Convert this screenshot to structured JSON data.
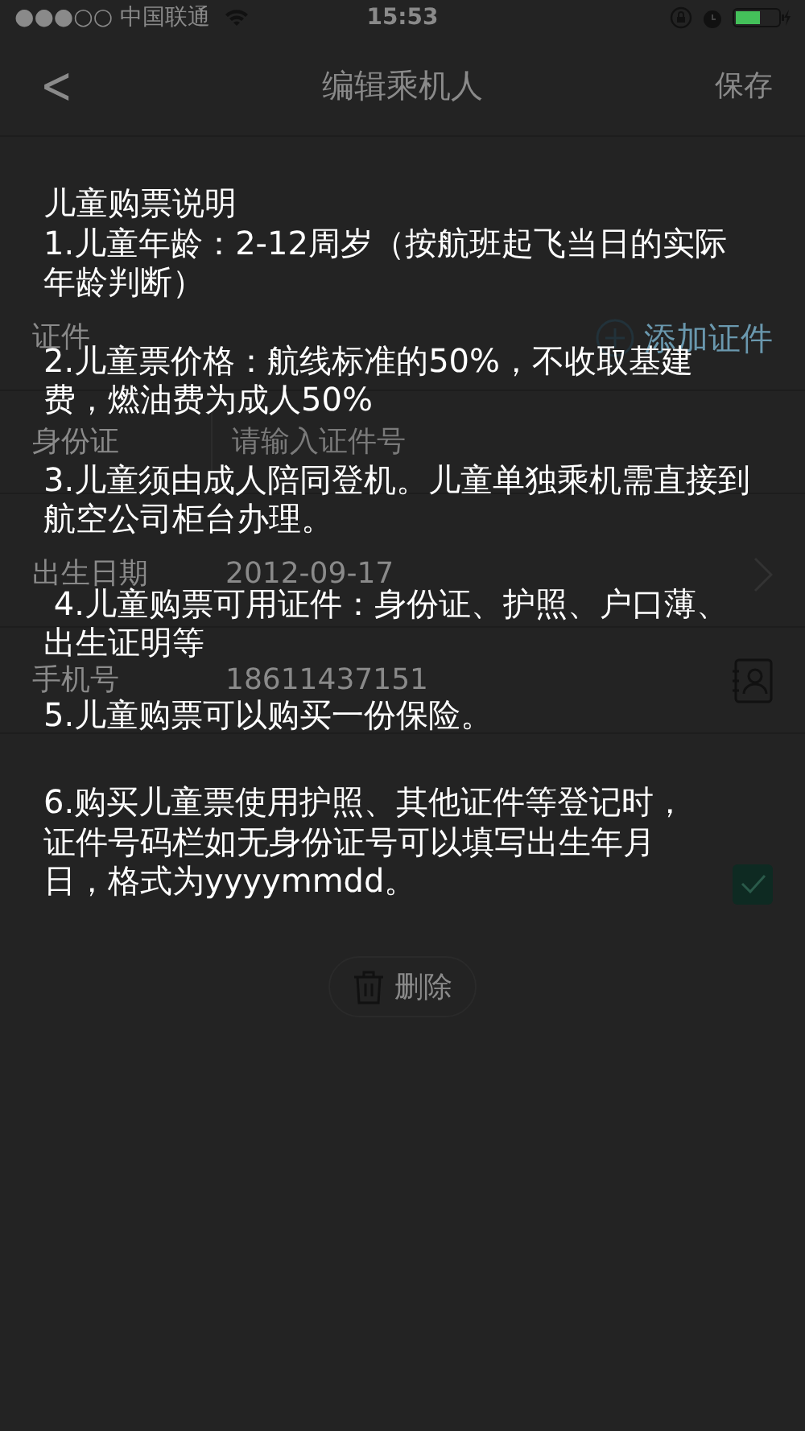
{
  "status_bar": {
    "carrier": "●●●○○ 中国联通",
    "time": "15:53"
  },
  "nav": {
    "back": "<",
    "title": "编辑乘机人",
    "action": "保存"
  },
  "form": {
    "id_section": {
      "label": "证件",
      "add": "添加证件"
    },
    "id_row": {
      "type": "身份证",
      "placeholder": "请输入证件号"
    },
    "rows": [
      {
        "kind": "chevron",
        "label": "出生日期",
        "value": "2012-09-17"
      },
      {
        "kind": "contact",
        "label": "手机号",
        "value": "18611437151"
      }
    ],
    "self_checkbox": {
      "checked": true
    },
    "delete": "删除"
  },
  "notice": {
    "title": "儿童购票说明",
    "items": [
      "1.儿童年龄：2-12周岁（按航班起飞当日的实际年龄判断）",
      "2.儿童票价格：航线标准的50%，不收取基建费，燃油费为成人50%",
      "3.儿童须由成人陪同登机。儿童单独乘机需直接到航空公司柜台办理。",
      " 4.儿童购票可用证件：身份证、护照、户口薄、出生证明等",
      "5.儿童购票可以购买一份保险。",
      "6.购买儿童票使用护照、其他证件等登记时，证件号码栏如无身份证号可以填写出生年月日，格式为yyyymmdd。"
    ]
  }
}
